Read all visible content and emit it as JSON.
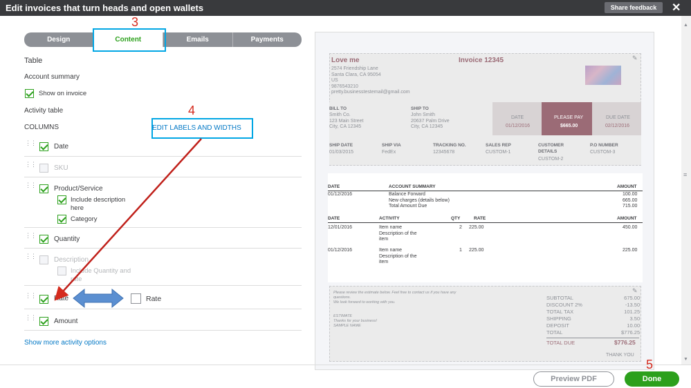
{
  "header": {
    "title": "Edit invoices that turn heads and open wallets",
    "share_label": "Share feedback",
    "close": "✕"
  },
  "tabs": [
    "Design",
    "Content",
    "Emails",
    "Payments"
  ],
  "annotations": {
    "a3": "3",
    "a4": "4",
    "a5": "5"
  },
  "left": {
    "table": "Table",
    "account_summary": "Account summary",
    "show_on_invoice": "Show on invoice",
    "activity_table": "Activity table",
    "columns": "COLUMNS",
    "edit_labels": "EDIT LABELS AND WIDTHS",
    "rows": {
      "date": "Date",
      "sku": "SKU",
      "product": "Product/Service",
      "include_desc": "Include description",
      "here": "here",
      "category": "Category",
      "quantity": "Quantity",
      "description": "Description",
      "include_qty": "Include Quantity and",
      "rate_cont": "rate",
      "rate": "Rate",
      "rate2": "Rate",
      "amount": "Amount"
    },
    "show_more": "Show more activity options"
  },
  "invoice": {
    "company": "Love me",
    "address": "2574 Friendship Lane\nSanta Clara, CA 95054\nUS\n9876543210\npretty.businesstestemail@gmail.com",
    "invoice_no": "Invoice 12345",
    "bill_to_h": "BILL TO",
    "bill_to": "Smith Co.\n123 Main Street\nCity, CA 12345",
    "ship_to_h": "SHIP TO",
    "ship_to": "John Smith\n20637 Palm Drive\nCity, CA 12345",
    "date_h": "DATE",
    "date": "01/12/2016",
    "please_pay_h": "PLEASE PAY",
    "please_pay": "$665.00",
    "due_h": "DUE DATE",
    "due": "02/12/2016",
    "ship_date_h": "SHIP DATE",
    "ship_date": "01/03/2015",
    "ship_via_h": "SHIP VIA",
    "ship_via": "FedEx",
    "tracking_h": "TRACKING NO.",
    "tracking": "12345678",
    "sales_rep_h": "SALES REP",
    "sales_rep": "CUSTOM-1",
    "cust_det_h": "CUSTOMER\nDETAILS",
    "cust_det": "CUSTOM-2",
    "po_h": "P.O NUMBER",
    "po": "CUSTOM-3",
    "acct_headers": {
      "date": "DATE",
      "summary": "ACCOUNT SUMMARY",
      "amount": "AMOUNT"
    },
    "acct_date": "01/12/2016",
    "acct_lines": "Balance Forward\nNew charges (details below)\nTotal Amount Due",
    "acct_amounts": "100.00\n665.00\n715.00",
    "act_headers": {
      "date": "DATE",
      "activity": "ACTIVITY",
      "qty": "QTY",
      "rate": "RATE",
      "amount": "AMOUNT"
    },
    "items": [
      {
        "date": "12/01/2016",
        "activity": "Item name\nDescription of the\nitem",
        "qty": "2",
        "rate": "225.00",
        "amount": "450.00"
      },
      {
        "date": "01/12/2016",
        "activity": "Item name\nDescription of the\nitem",
        "qty": "1",
        "rate": "225.00",
        "amount": "225.00"
      }
    ],
    "footer_msg": "Please review the estimate below. Feel free to contact us if you have any\nquestions.\nWe look forward to working with you.",
    "footer_msg2": "ESTIMATE\nThanks for your business!\nSAMPLE NAME",
    "totals_labels": "SUBTOTAL\nDISCOUNT 2%\nTOTAL TAX\nSHIPPING\nDEPOSIT\nTOTAL",
    "totals_values": "675.00\n-13.50\n101.25\n3.50\n10.00\n$776.25",
    "total_due_h": "TOTAL DUE",
    "total_due": "$776.25",
    "thank_you": "THANK YOU"
  },
  "footer": {
    "preview_pdf": "Preview PDF",
    "done": "Done"
  },
  "colors": {
    "green": "#2ca01c",
    "annotation_red": "#d52b1e",
    "highlight_blue": "#00a6e4",
    "please_pay_bg": "#9b6b76"
  }
}
